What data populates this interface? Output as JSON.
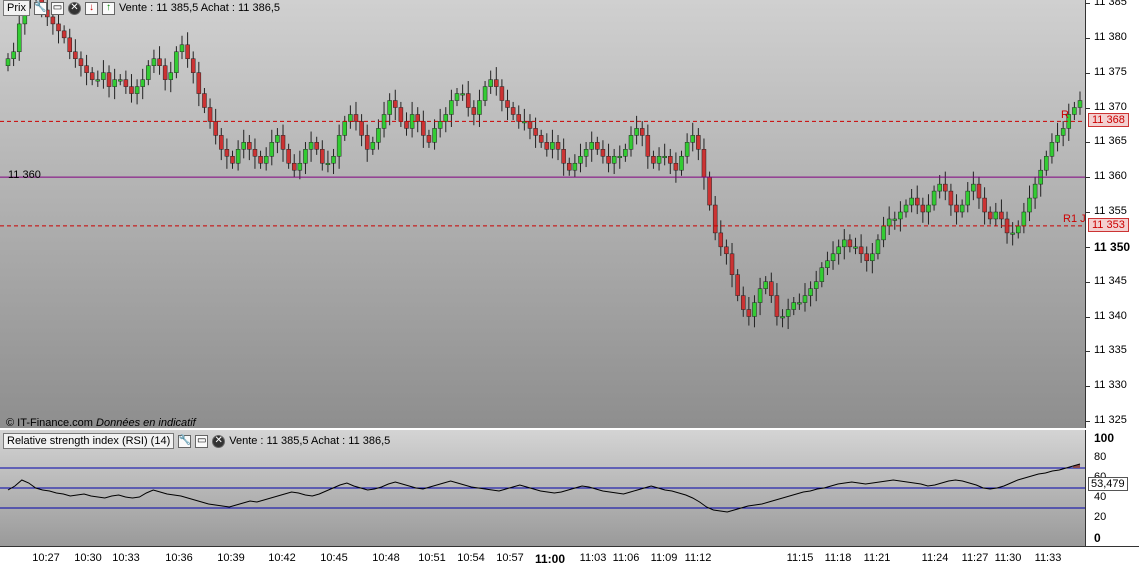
{
  "main": {
    "panel_label": "Prix",
    "quote_text": "Vente : 11 385,5 Achat : 11 386,5",
    "copyright_brand": "© IT-Finance.com",
    "copyright_note": "Données en indicatif",
    "horizontal_line_label": "11 360",
    "r1_tag_top": "R",
    "r1_tag_bottom": "R1 J",
    "level_badges": [
      "11 368",
      "11 353"
    ]
  },
  "rsi": {
    "panel_label": "Relative strength index (RSI) (14)",
    "quote_text": "Vente : 11 385,5 Achat : 11 386,5",
    "current_value_badge": "53,479"
  },
  "price_axis": {
    "ticks": [
      "11 385",
      "11 380",
      "11 375",
      "11 370",
      "11 365",
      "11 360",
      "11 355",
      "11 350",
      "11 345",
      "11 340",
      "11 335",
      "11 330",
      "11 325"
    ],
    "bold_tick": "11 350"
  },
  "rsi_axis": {
    "ticks": [
      "100",
      "80",
      "60",
      "40",
      "20",
      "0"
    ]
  },
  "time_axis": {
    "labels": [
      "10:27",
      "10:30",
      "10:33",
      "10:36",
      "10:39",
      "10:42",
      "10:45",
      "10:48",
      "10:51",
      "10:54",
      "10:57",
      "11:00",
      "11:03",
      "11:06",
      "11:09",
      "11:12",
      "11:15",
      "11:18",
      "11:21",
      "11:24",
      "11:27",
      "11:30",
      "11:33"
    ],
    "bold_label": "11:00"
  },
  "icons": {
    "settings": "wrench-icon",
    "window": "window-icon",
    "close": "close-icon",
    "sell_arrow": "down-arrow-icon",
    "buy_arrow": "up-arrow-icon"
  },
  "colors": {
    "bull_candle": "#33cc33",
    "bear_candle": "#cc3333",
    "hline": "#800080",
    "dashed_level": "#cc0000",
    "rsi_line": "#000000",
    "rsi_bands": "#0000aa",
    "rsi_overbought_fill": "#8b4a4a"
  },
  "chart_data": {
    "type": "candlestick",
    "ylim": [
      11323,
      11387
    ],
    "horizontal_line": 11360,
    "dashed_levels": [
      11368,
      11353
    ],
    "closes": [
      11377,
      11378,
      11382,
      11386,
      11387,
      11386,
      11384,
      11383,
      11382,
      11381,
      11380,
      11378,
      11377,
      11376,
      11375,
      11374,
      11374,
      11375,
      11373,
      11374,
      11374,
      11373,
      11372,
      11373,
      11374,
      11376,
      11377,
      11376,
      11374,
      11375,
      11378,
      11379,
      11377,
      11375,
      11372,
      11370,
      11368,
      11366,
      11364,
      11363,
      11362,
      11364,
      11365,
      11364,
      11363,
      11362,
      11363,
      11365,
      11366,
      11364,
      11362,
      11361,
      11362,
      11364,
      11365,
      11364,
      11362,
      11362,
      11363,
      11366,
      11368,
      11369,
      11368,
      11366,
      11364,
      11365,
      11367,
      11369,
      11371,
      11370,
      11368,
      11367,
      11369,
      11368,
      11366,
      11365,
      11367,
      11368,
      11369,
      11371,
      11372,
      11372,
      11370,
      11369,
      11371,
      11373,
      11374,
      11373,
      11371,
      11370,
      11369,
      11368,
      11368,
      11367,
      11366,
      11365,
      11364,
      11365,
      11364,
      11362,
      11361,
      11362,
      11363,
      11364,
      11365,
      11364,
      11363,
      11362,
      11363,
      11363,
      11364,
      11366,
      11367,
      11366,
      11363,
      11362,
      11363,
      11363,
      11362,
      11361,
      11363,
      11365,
      11366,
      11364,
      11360,
      11356,
      11352,
      11350,
      11349,
      11346,
      11343,
      11341,
      11340,
      11342,
      11344,
      11345,
      11343,
      11340,
      11340,
      11341,
      11342,
      11342,
      11343,
      11344,
      11345,
      11347,
      11348,
      11349,
      11350,
      11351,
      11350,
      11350,
      11349,
      11348,
      11349,
      11351,
      11353,
      11354,
      11354,
      11355,
      11356,
      11357,
      11356,
      11355,
      11356,
      11358,
      11359,
      11358,
      11356,
      11355,
      11356,
      11358,
      11359,
      11357,
      11355,
      11354,
      11355,
      11354,
      11352,
      11352,
      11353,
      11355,
      11357,
      11359,
      11361,
      11363,
      11365,
      11366,
      11367,
      11369,
      11370,
      11371
    ],
    "rsi_values": [
      48,
      52,
      58,
      55,
      50,
      48,
      47,
      45,
      44,
      42,
      43,
      44,
      42,
      41,
      40,
      42,
      43,
      41,
      40,
      41,
      45,
      48,
      46,
      44,
      43,
      42,
      40,
      38,
      36,
      34,
      33,
      32,
      31,
      33,
      35,
      37,
      36,
      38,
      40,
      42,
      44,
      46,
      45,
      43,
      42,
      44,
      47,
      50,
      53,
      55,
      52,
      50,
      48,
      49,
      51,
      54,
      56,
      54,
      52,
      50,
      49,
      51,
      53,
      55,
      57,
      55,
      53,
      51,
      50,
      49,
      48,
      47,
      49,
      51,
      53,
      51,
      49,
      47,
      46,
      45,
      46,
      48,
      50,
      52,
      51,
      49,
      47,
      46,
      45,
      44,
      46,
      48,
      50,
      52,
      50,
      48,
      47,
      45,
      43,
      40,
      36,
      31,
      28,
      27,
      26,
      28,
      30,
      32,
      33,
      34,
      36,
      38,
      40,
      42,
      44,
      46,
      47,
      49,
      50,
      52,
      54,
      55,
      56,
      55,
      54,
      55,
      56,
      57,
      58,
      57,
      56,
      55,
      54,
      52,
      53,
      55,
      57,
      58,
      57,
      55,
      53,
      50,
      49,
      50,
      52,
      55,
      58,
      60,
      62,
      64,
      65,
      67,
      68,
      70,
      72,
      74
    ],
    "rsi_levels": [
      70,
      50,
      30
    ],
    "rsi_current": 53.479,
    "rsi_ylim": [
      0,
      100
    ],
    "x_tick_labels": [
      "10:27",
      "10:30",
      "10:33",
      "10:36",
      "10:39",
      "10:42",
      "10:45",
      "10:48",
      "10:51",
      "10:54",
      "10:57",
      "11:00",
      "11:03",
      "11:06",
      "11:09",
      "11:12",
      "11:15",
      "11:18",
      "11:21",
      "11:24",
      "11:27",
      "11:30",
      "11:33"
    ]
  }
}
